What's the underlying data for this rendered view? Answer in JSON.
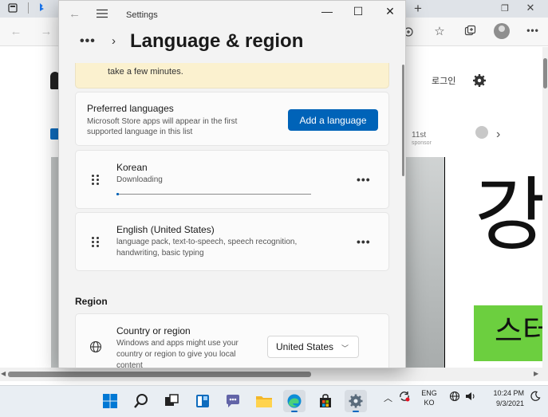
{
  "browser": {
    "login_link": "로그인",
    "ad_label": "11st",
    "ad_sub": "sponsor",
    "ad_big_text": "강",
    "ad_green_text": "스터"
  },
  "settings": {
    "app_title": "Settings",
    "breadcrumb_more": "•••",
    "page_title": "Language & region",
    "banner_text": "take a few minutes.",
    "preferred": {
      "title": "Preferred languages",
      "description": "Microsoft Store apps will appear in the first supported language in this list",
      "add_button": "Add a language"
    },
    "languages": [
      {
        "name": "Korean",
        "status": "Downloading",
        "progress": 0.01
      },
      {
        "name": "English (United States)",
        "status": "language pack, text-to-speech, speech recognition, handwriting, basic typing"
      }
    ],
    "more_label": "•••",
    "region": {
      "section_title": "Region",
      "country_title": "Country or region",
      "country_desc": "Windows and apps might use your country or region to give you local content",
      "country_value": "United States"
    }
  },
  "taskbar": {
    "lang_top": "ENG",
    "lang_bottom": "KO",
    "time": "10:24 PM",
    "date": "9/3/2021"
  },
  "colors": {
    "accent": "#0063b8",
    "banner": "#fbf1cf",
    "ad_green": "#6ccf3f"
  }
}
